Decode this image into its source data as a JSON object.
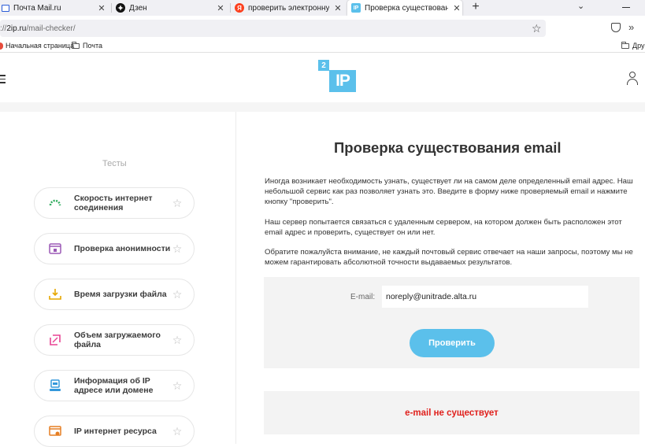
{
  "browser": {
    "tabs": [
      {
        "title": "Почта Mail.ru",
        "icon": "mail-ru-icon",
        "active": false
      },
      {
        "title": "Дзен",
        "icon": "dzen-icon",
        "active": false
      },
      {
        "title": "проверить электронную почт",
        "icon": "yandex-icon",
        "active": false
      },
      {
        "title": "Проверка существования em",
        "icon": "2ip-icon",
        "active": true
      }
    ],
    "close_glyph": "✕",
    "new_tab_glyph": "+",
    "url": {
      "scheme": "://",
      "host": "2ip.ru",
      "path": "/mail-checker/"
    },
    "bookmarks": [
      {
        "label": "Начальная страница"
      },
      {
        "label": "Почта"
      },
      {
        "label": "Друг"
      }
    ]
  },
  "site": {
    "logo": {
      "small": "2",
      "big": "IP"
    },
    "accent_color": "#5bc0eb"
  },
  "sidebar": {
    "heading": "Тесты",
    "items": [
      {
        "label": "Скорость интернет соединения",
        "icon": "speedometer-icon"
      },
      {
        "label": "Проверка анонимности",
        "icon": "anonymity-window-icon"
      },
      {
        "label": "Время загрузки файла",
        "icon": "download-tray-icon"
      },
      {
        "label": "Объем загружаемого файла",
        "icon": "file-size-icon"
      },
      {
        "label": "Информация об IP адресе или домене",
        "icon": "ip-info-icon"
      },
      {
        "label": "IP интернет ресурса",
        "icon": "resource-ip-icon"
      }
    ]
  },
  "main": {
    "title": "Проверка существования email",
    "paragraphs": [
      "Иногда возникает необходимость узнать, существует ли на самом деле определенный email адрес. Наш небольшой сервис как раз позволяет узнать это. Введите в форму ниже проверяемый email и нажмите кнопку \"проверить\".",
      "Наш сервер попытается связаться с удаленным сервером, на котором должен быть расположен этот email адрес и проверить, существует он или нет.",
      "Обратите пожалуйста внимание, не каждый почтовый сервис отвечает на наши запросы, поэтому мы не можем гарантировать абсолютной точности выдаваемых результатов."
    ],
    "form": {
      "email_label": "E-mail:",
      "email_value": "noreply@unitrade.alta.ru",
      "submit_label": "Проверить"
    },
    "result": {
      "text": "e-mail не существует",
      "color": "#e0201c"
    }
  }
}
